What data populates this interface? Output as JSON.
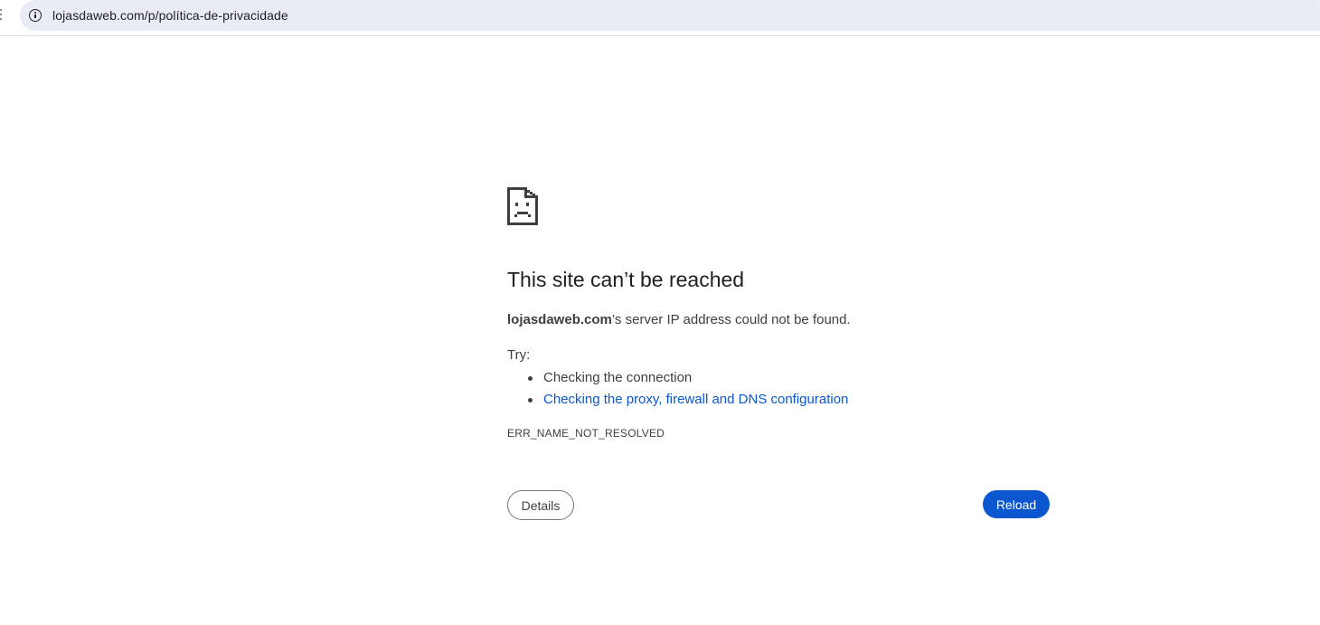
{
  "browser": {
    "url": "lojasdaweb.com/p/política-de-privacidade",
    "icons": {
      "site_info": "info-circle-icon",
      "error_page": "sad-page-icon"
    }
  },
  "error_page": {
    "title": "This site can’t be reached",
    "host": "lojasdaweb.com",
    "message_suffix": "’s server IP address could not be found.",
    "try_label": "Try:",
    "suggestions": [
      {
        "text": "Checking the connection",
        "is_link": false
      },
      {
        "text": "Checking the proxy, firewall and DNS configuration",
        "is_link": true
      }
    ],
    "error_code": "ERR_NAME_NOT_RESOLVED",
    "details_label": "Details",
    "reload_label": "Reload"
  },
  "colors": {
    "omnibox_bg": "#e9ecf4",
    "link": "#0b57d0",
    "primary_button": "#0b57d0",
    "text": "#202124",
    "secondary_text": "#3c4043"
  }
}
